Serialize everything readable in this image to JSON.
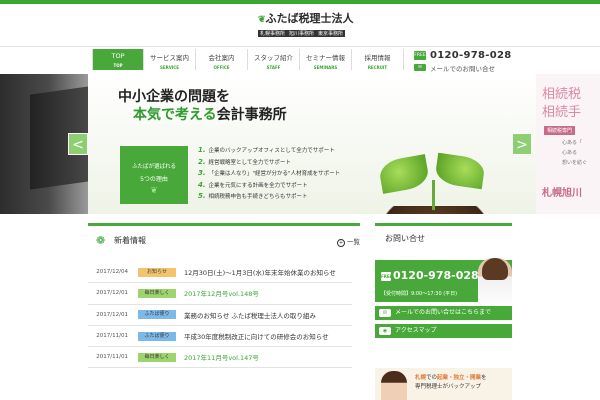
{
  "header": {
    "logo_name": "ふたば税理士法人",
    "logo_subs": [
      "札幌事務所",
      "旭川事務所",
      "東京事務所"
    ],
    "contact_tel": "0120-978-028",
    "contact_tel_icon": "FREE",
    "contact_mail": "メールでのお問い合せ"
  },
  "nav": [
    {
      "jp": "TOP",
      "en": "TOP"
    },
    {
      "jp": "サービス案内",
      "en": "SERVICE"
    },
    {
      "jp": "会社案内",
      "en": "OFFICE"
    },
    {
      "jp": "スタッフ紹介",
      "en": "STAFF"
    },
    {
      "jp": "セミナー情報",
      "en": "SEMINARS"
    },
    {
      "jp": "採用情報",
      "en": "RECRUIT"
    }
  ],
  "hero": {
    "line1": "中小企業の問題を",
    "line2a": "本気で考える",
    "line2b": "会計事務所",
    "reason_t1": "ふたばが選ばれる",
    "reason_t2": "5つの理由",
    "points": [
      {
        "num": "1.",
        "text": "企業のバックアップオフィスとして全力でサポート"
      },
      {
        "num": "2.",
        "text": "経営戦略室として全力でサポート"
      },
      {
        "num": "3.",
        "text": "「企業は人なり」\"経営が分かる\"人材育成をサポート"
      },
      {
        "num": "4.",
        "text": "企業を元気にする計画を全力でサポート"
      },
      {
        "num": "5.",
        "text": "相続税務申告も手続きどちらもサポート"
      }
    ],
    "prev": "<",
    "next": ">"
  },
  "side_panel": {
    "big1": "相続税",
    "big2": "相続手",
    "badge": "相続税専門",
    "small": [
      "心ある「",
      "心ある",
      "想いを紡ぐ"
    ],
    "sapporo": "札幌旭川"
  },
  "news": {
    "title": "新着情報",
    "more": "一覧",
    "items": [
      {
        "date": "2017/12/04",
        "cat": "お知らせ",
        "type": "notice",
        "title": "12月30日(土)〜1月3日(水)年末年始休業のお知らせ"
      },
      {
        "date": "2017/12/01",
        "cat": "毎日楽しく",
        "type": "daily",
        "title": "2017年12月号vol.148号"
      },
      {
        "date": "2017/12/01",
        "cat": "ふたば便り",
        "type": "news",
        "title": "業務のお知らせ ふたば税理士法人の取り組み"
      },
      {
        "date": "2017/11/01",
        "cat": "ふたば便り",
        "type": "news",
        "title": "平成30年度税制改正に向けての研修会のお知らせ"
      },
      {
        "date": "2017/11/01",
        "cat": "毎日楽しく",
        "type": "daily",
        "title": "2017年11月号vol.147号"
      }
    ]
  },
  "inquiry": {
    "title": "お問い合せ",
    "tel": "0120-978-028",
    "tel_icon": "FREE",
    "hours": "【受付時間】9:00〜17:30 (平日)",
    "mail_btn": "メールでのお問い合せはこちらまで",
    "access_btn": "アクセスマップ"
  },
  "banner": {
    "line1a": "札幌",
    "line1b": "での",
    "line1c": "起業・独立・開業",
    "line1d": "を",
    "line2": "専門税理士がバックアップ"
  }
}
